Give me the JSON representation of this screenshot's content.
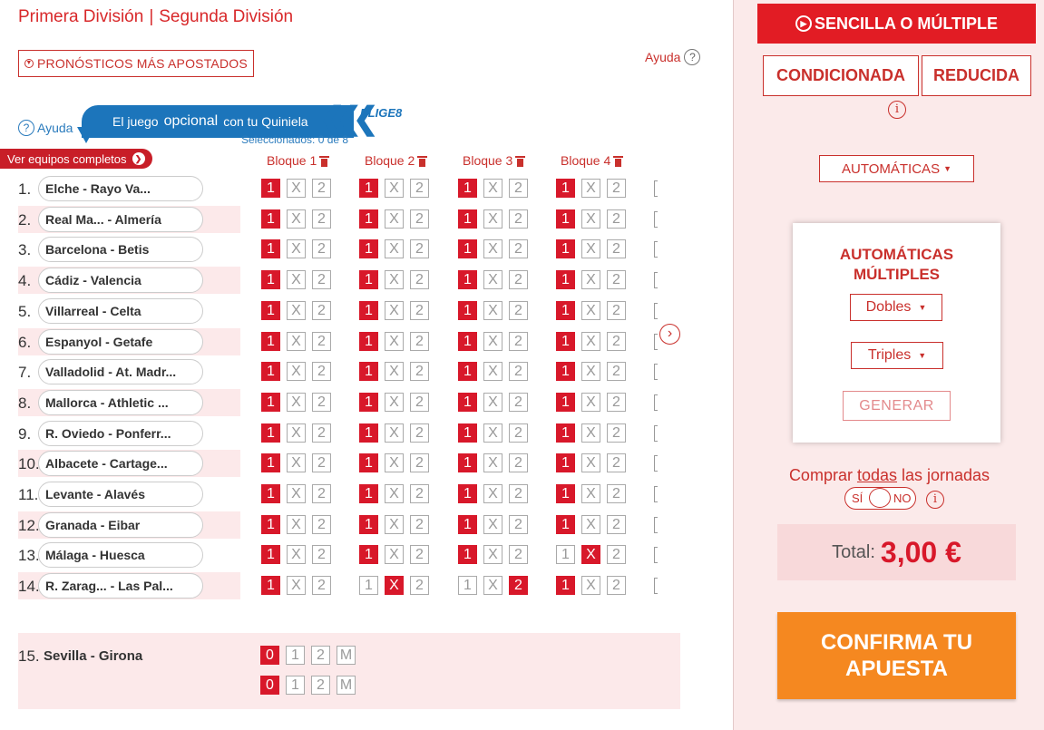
{
  "header": {
    "tabs": [
      "Primera División",
      "Segunda División"
    ],
    "separator": "|",
    "pronosticos_label": "PRONÓSTICOS MÁS APOSTADOS",
    "ayuda_label": "Ayuda"
  },
  "elige8": {
    "ayuda_label": "Ayuda",
    "banner_prefix": "El juego",
    "banner_word": "opcional",
    "banner_suffix": "con tu Quiniela",
    "logo": "ELIGE8",
    "seleccionados": "Seleccionados: 0 de 8"
  },
  "ver_equipos_label": "Ver equipos completos",
  "blocks": [
    "Bloque 1",
    "Bloque 2",
    "Bloque 3",
    "Bloque 4"
  ],
  "signs": [
    "1",
    "X",
    "2"
  ],
  "matches": [
    {
      "num": "1.",
      "match": "Elche - Rayo Va...",
      "picks": [
        0,
        0,
        0,
        0
      ]
    },
    {
      "num": "2.",
      "match": "Real Ma... - Almería",
      "picks": [
        0,
        0,
        0,
        0
      ]
    },
    {
      "num": "3.",
      "match": "Barcelona - Betis",
      "picks": [
        0,
        0,
        0,
        0
      ]
    },
    {
      "num": "4.",
      "match": "Cádiz - Valencia",
      "picks": [
        0,
        0,
        0,
        0
      ]
    },
    {
      "num": "5.",
      "match": "Villarreal - Celta",
      "picks": [
        0,
        0,
        0,
        0
      ]
    },
    {
      "num": "6.",
      "match": "Espanyol - Getafe",
      "picks": [
        0,
        0,
        0,
        0
      ]
    },
    {
      "num": "7.",
      "match": "Valladolid - At. Madr...",
      "picks": [
        0,
        0,
        0,
        0
      ]
    },
    {
      "num": "8.",
      "match": "Mallorca - Athletic ...",
      "picks": [
        0,
        0,
        0,
        0
      ]
    },
    {
      "num": "9.",
      "match": "R. Oviedo - Ponferr...",
      "picks": [
        0,
        0,
        0,
        0
      ]
    },
    {
      "num": "10.",
      "match": "Albacete - Cartage...",
      "picks": [
        0,
        0,
        0,
        0
      ]
    },
    {
      "num": "11.",
      "match": "Levante - Alavés",
      "picks": [
        0,
        0,
        0,
        0
      ]
    },
    {
      "num": "12.",
      "match": "Granada - Eibar",
      "picks": [
        0,
        0,
        0,
        0
      ]
    },
    {
      "num": "13.",
      "match": "Málaga - Huesca",
      "picks": [
        0,
        0,
        0,
        1
      ]
    },
    {
      "num": "14.",
      "match": "R. Zarag... - Las Pal...",
      "picks": [
        0,
        1,
        2,
        0
      ]
    }
  ],
  "pleno": {
    "num": "15.",
    "match": "Sevilla - Girona",
    "signs": [
      "0",
      "1",
      "2",
      "M"
    ],
    "picks": [
      0,
      0
    ]
  },
  "sidebar": {
    "sencilla_label": "SENCILLA O MÚLTIPLE",
    "condicionada_label": "CONDICIONADA",
    "reducida_label": "REDUCIDA",
    "info_glyph": "i",
    "automaticas_label": "AUTOMÁTICAS",
    "panel_title_1": "AUTOMÁTICAS",
    "panel_title_2": "MÚLTIPLES",
    "dobles_label": "Dobles",
    "triples_label": "Triples",
    "generar_label": "GENERAR",
    "comprar_prefix": "Comprar ",
    "comprar_link": "todas",
    "comprar_suffix": " las jornadas",
    "toggle_si": "SÍ",
    "toggle_no": "NO",
    "total_label": "Total:",
    "total_value": "3,00 €",
    "confirma_line1": "CONFIRMA TU",
    "confirma_line2": "APUESTA"
  },
  "colors": {
    "brand_red": "#d8182a",
    "cta_orange": "#f58820",
    "elige_blue": "#1c75bb"
  }
}
